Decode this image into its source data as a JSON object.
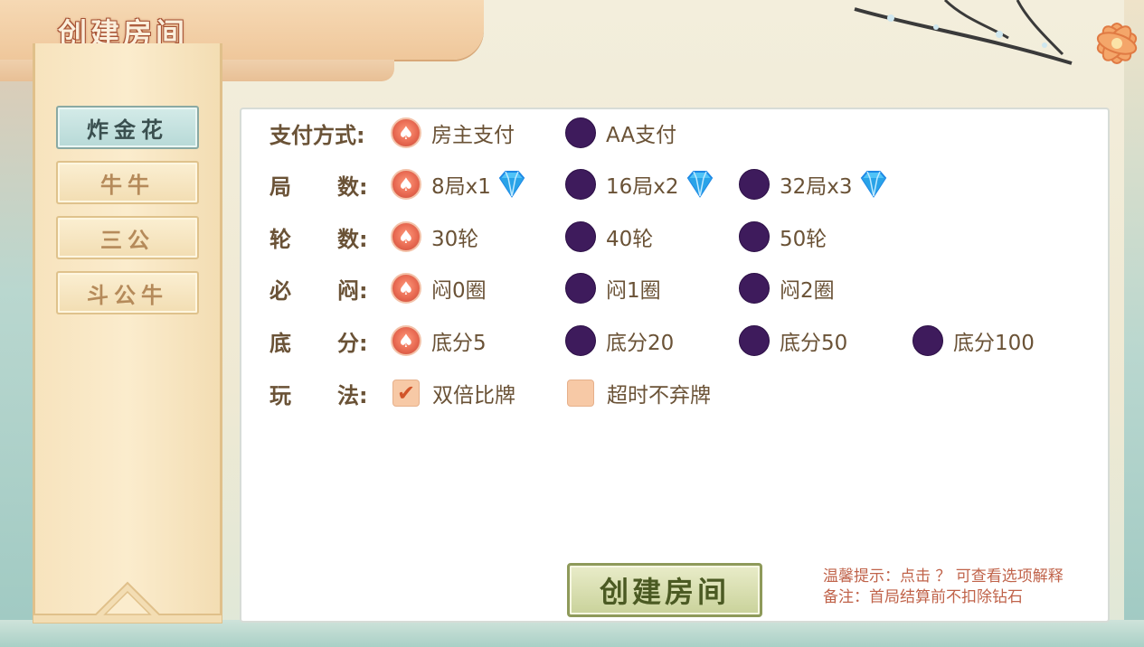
{
  "header": {
    "title": "创建房间"
  },
  "games": [
    {
      "label": "炸金花",
      "active": true
    },
    {
      "label": "牛牛",
      "active": false
    },
    {
      "label": "三公",
      "active": false
    },
    {
      "label": "斗公牛",
      "active": false
    }
  ],
  "rows": {
    "pay": {
      "label": "支付方式:",
      "options": [
        "房主支付",
        "AA支付"
      ],
      "selected": 0
    },
    "rounds": {
      "label_a": "局",
      "label_b": "数:",
      "options": [
        "8局x1",
        "16局x2",
        "32局x3"
      ],
      "selected": 0
    },
    "turns": {
      "label_a": "轮",
      "label_b": "数:",
      "options": [
        "30轮",
        "40轮",
        "50轮"
      ],
      "selected": 0
    },
    "blind": {
      "label_a": "必",
      "label_b": "闷:",
      "options": [
        "闷0圈",
        "闷1圈",
        "闷2圈"
      ],
      "selected": 0
    },
    "base": {
      "label_a": "底",
      "label_b": "分:",
      "options": [
        "底分5",
        "底分20",
        "底分50",
        "底分100"
      ],
      "selected": 0
    },
    "play": {
      "label_a": "玩",
      "label_b": "法:",
      "options": [
        {
          "label": "双倍比牌",
          "checked": true
        },
        {
          "label": "超时不弃牌",
          "checked": false
        }
      ]
    }
  },
  "buttons": {
    "create": "创建房间"
  },
  "tips": {
    "line1": "温馨提示：点击 ？ 可查看选项解释",
    "line2": "备注：首局结算前不扣除钻石"
  },
  "icons": {
    "selected_radio": "spade-icon",
    "cost": "diamond-icon"
  },
  "colors": {
    "radio_off": "#3e1b5c",
    "radio_on": "#e86a52",
    "label_text": "#6a5236",
    "tip_text": "#c0634a"
  }
}
